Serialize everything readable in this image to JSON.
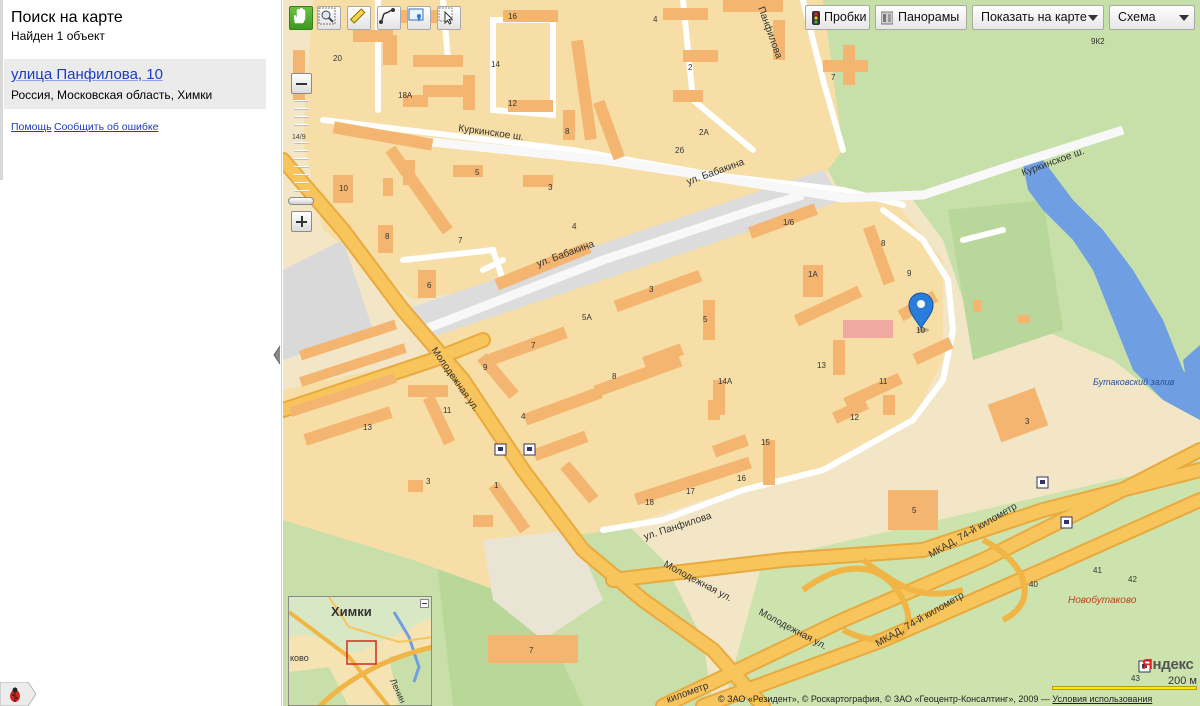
{
  "search": {
    "title": "Поиск на карте",
    "found": "Найден 1 объект",
    "result": {
      "title": "улица Панфилова, 10",
      "address": "Россия, Московская область, Химки"
    },
    "help_link": "Помощь",
    "report_link": "Сообщить об ошибке"
  },
  "toolbar": {
    "tools": [
      {
        "icon": "hand-icon",
        "active": true
      },
      {
        "icon": "magnifier-icon",
        "active": false
      },
      {
        "icon": "ruler-icon",
        "active": false
      },
      {
        "icon": "route-icon",
        "active": false
      },
      {
        "icon": "add-placemark-icon",
        "active": false
      },
      {
        "icon": "select-cursor-icon",
        "active": false
      }
    ],
    "traffic_label": "Пробки",
    "panoramas_label": "Панорамы",
    "show_on_map_label": "Показать на карте",
    "map_type_label": "Схема"
  },
  "zoom": {
    "level_label": "14/9"
  },
  "map": {
    "streets": {
      "kurkinskoe_1": "Куркинское ш.",
      "kurkinskoe_2": "Куркинское ш.",
      "babakina_1": "ул. Бабакина",
      "babakina_2": "ул. Бабакина",
      "molodezhnaya_1": "Молодежная ул.",
      "molodezhnaya_2": "Молодежная ул.",
      "molodezhnaya_3": "Молодежная ул.",
      "panfilova_1": "ул. Панфилова",
      "panfilova_2": "Панфилова",
      "mkad_1": "МКАД, 74-й километр",
      "mkad_2": "МКАД, 74-й километр",
      "mkad_3": "километр"
    },
    "places": {
      "butakovsky_bay": "Бутаковский залив",
      "novobutakovo": "Новобутаково"
    },
    "building_numbers": {
      "n16": "16",
      "n4a": "4",
      "n20": "20",
      "n14": "14",
      "n18A": "18А",
      "n12": "12",
      "n8a": "8",
      "n2": "2",
      "n2A": "2А",
      "n2b": "2б",
      "n7a": "7",
      "n9K2": "9К2",
      "n10": "10",
      "n5a": "5",
      "n3a": "3",
      "n8b": "8",
      "n7b": "7",
      "n6": "6",
      "n4b": "4",
      "n16_1": "1/6",
      "n8c": "8",
      "n9a": "9",
      "n1A": "1А",
      "n10b": "10",
      "n3b": "3",
      "n5A": "5А",
      "n5b": "5",
      "n7c": "7",
      "n9b": "9",
      "n13a": "13",
      "n8d": "8",
      "n14A": "14А",
      "n11a": "11",
      "n12b": "12",
      "n4c": "4",
      "n11b": "11",
      "n13b": "13",
      "n15": "15",
      "n16b": "16",
      "n17": "17",
      "n18": "18",
      "n3c": "3",
      "n1": "1",
      "n3d": "3",
      "n5c": "5",
      "n7d": "7",
      "n40": "40",
      "n41": "41",
      "n42": "42",
      "n43": "43"
    }
  },
  "minimap": {
    "city": "Химки",
    "label_left": "ково",
    "label_road": "Ленин"
  },
  "scale": {
    "label": "200 м"
  },
  "copyright": {
    "text": "© ЗАО «Резидент», © Роскартография, © ЗАО «Геоцентр-Консалтинг», 2009 — ",
    "terms_link": "Условия использования"
  },
  "logo": {
    "first_letter": "Я",
    "rest": "ндекс"
  },
  "colors": {
    "land": "#f2e6c6",
    "residential": "#f6dea6",
    "building": "#f3b56f",
    "major_road": "#f1b545",
    "park": "#c8dfa9",
    "water": "#6d9fe3",
    "placemark": "#2b7ddb"
  }
}
